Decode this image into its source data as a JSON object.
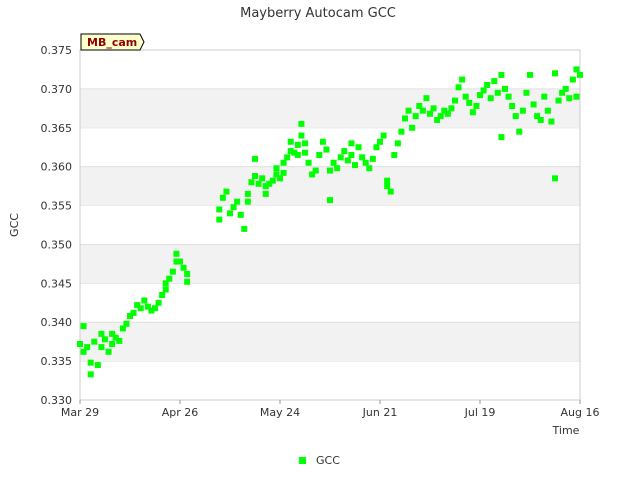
{
  "chart_data": {
    "type": "scatter",
    "title": "Mayberry Autocam GCC",
    "xlabel": "Time",
    "ylabel": "GCC",
    "site_tag": "MB_cam",
    "x_ticks": [
      "Mar 29",
      "Apr 26",
      "May 24",
      "Jun 21",
      "Jul 19",
      "Aug 16"
    ],
    "xlim": [
      "2016-03-29",
      "2016-08-16"
    ],
    "ylim": [
      0.33,
      0.375
    ],
    "y_ticks": [
      "0.330",
      "0.335",
      "0.340",
      "0.345",
      "0.350",
      "0.355",
      "0.360",
      "0.365",
      "0.370",
      "0.375"
    ],
    "grid": "alternating horizontal bands",
    "legend": "bottom-center",
    "colors": {
      "series": "#00ff00",
      "band": "#f2f2f2",
      "tag_bg": "#ffffcc"
    },
    "series": [
      {
        "name": "GCC",
        "points": [
          [
            "2016-03-29",
            0.3372
          ],
          [
            "2016-03-30",
            0.3362
          ],
          [
            "2016-03-30",
            0.3395
          ],
          [
            "2016-03-31",
            0.3368
          ],
          [
            "2016-04-01",
            0.3348
          ],
          [
            "2016-04-01",
            0.3333
          ],
          [
            "2016-04-02",
            0.3375
          ],
          [
            "2016-04-03",
            0.3345
          ],
          [
            "2016-04-04",
            0.3385
          ],
          [
            "2016-04-04",
            0.3368
          ],
          [
            "2016-04-05",
            0.3378
          ],
          [
            "2016-04-06",
            0.3362
          ],
          [
            "2016-04-07",
            0.3385
          ],
          [
            "2016-04-07",
            0.3372
          ],
          [
            "2016-04-08",
            0.338
          ],
          [
            "2016-04-09",
            0.3376
          ],
          [
            "2016-04-10",
            0.3392
          ],
          [
            "2016-04-11",
            0.3398
          ],
          [
            "2016-04-12",
            0.3408
          ],
          [
            "2016-04-13",
            0.3412
          ],
          [
            "2016-04-14",
            0.3422
          ],
          [
            "2016-04-15",
            0.3418
          ],
          [
            "2016-04-16",
            0.3428
          ],
          [
            "2016-04-17",
            0.342
          ],
          [
            "2016-04-18",
            0.3415
          ],
          [
            "2016-04-19",
            0.3418
          ],
          [
            "2016-04-20",
            0.3425
          ],
          [
            "2016-04-21",
            0.3435
          ],
          [
            "2016-04-22",
            0.3442
          ],
          [
            "2016-04-22",
            0.345
          ],
          [
            "2016-04-23",
            0.3456
          ],
          [
            "2016-04-24",
            0.3465
          ],
          [
            "2016-04-25",
            0.3478
          ],
          [
            "2016-04-25",
            0.3488
          ],
          [
            "2016-04-26",
            0.3478
          ],
          [
            "2016-04-27",
            0.347
          ],
          [
            "2016-04-28",
            0.3462
          ],
          [
            "2016-04-28",
            0.3452
          ],
          [
            "2016-05-07",
            0.3532
          ],
          [
            "2016-05-07",
            0.3545
          ],
          [
            "2016-05-08",
            0.356
          ],
          [
            "2016-05-09",
            0.3568
          ],
          [
            "2016-05-10",
            0.354
          ],
          [
            "2016-05-11",
            0.3548
          ],
          [
            "2016-05-12",
            0.3555
          ],
          [
            "2016-05-13",
            0.3538
          ],
          [
            "2016-05-14",
            0.352
          ],
          [
            "2016-05-15",
            0.3565
          ],
          [
            "2016-05-15",
            0.3555
          ],
          [
            "2016-05-16",
            0.358
          ],
          [
            "2016-05-17",
            0.3588
          ],
          [
            "2016-05-17",
            0.361
          ],
          [
            "2016-05-18",
            0.3578
          ],
          [
            "2016-05-19",
            0.3585
          ],
          [
            "2016-05-20",
            0.3565
          ],
          [
            "2016-05-20",
            0.3575
          ],
          [
            "2016-05-21",
            0.3578
          ],
          [
            "2016-05-22",
            0.3582
          ],
          [
            "2016-05-23",
            0.359
          ],
          [
            "2016-05-23",
            0.3598
          ],
          [
            "2016-05-24",
            0.3585
          ],
          [
            "2016-05-25",
            0.3592
          ],
          [
            "2016-05-25",
            0.3605
          ],
          [
            "2016-05-26",
            0.3612
          ],
          [
            "2016-05-27",
            0.362
          ],
          [
            "2016-05-27",
            0.3632
          ],
          [
            "2016-05-28",
            0.3618
          ],
          [
            "2016-05-29",
            0.3615
          ],
          [
            "2016-05-29",
            0.3628
          ],
          [
            "2016-05-30",
            0.364
          ],
          [
            "2016-05-30",
            0.3655
          ],
          [
            "2016-05-31",
            0.363
          ],
          [
            "2016-05-31",
            0.3618
          ],
          [
            "2016-06-01",
            0.3605
          ],
          [
            "2016-06-02",
            0.359
          ],
          [
            "2016-06-03",
            0.3595
          ],
          [
            "2016-06-04",
            0.3615
          ],
          [
            "2016-06-05",
            0.3632
          ],
          [
            "2016-06-06",
            0.3622
          ],
          [
            "2016-06-07",
            0.3557
          ],
          [
            "2016-06-07",
            0.3595
          ],
          [
            "2016-06-08",
            0.3605
          ],
          [
            "2016-06-09",
            0.3598
          ],
          [
            "2016-06-10",
            0.3612
          ],
          [
            "2016-06-11",
            0.362
          ],
          [
            "2016-06-12",
            0.3608
          ],
          [
            "2016-06-13",
            0.3615
          ],
          [
            "2016-06-13",
            0.363
          ],
          [
            "2016-06-14",
            0.3602
          ],
          [
            "2016-06-15",
            0.3625
          ],
          [
            "2016-06-16",
            0.3612
          ],
          [
            "2016-06-17",
            0.3605
          ],
          [
            "2016-06-18",
            0.3598
          ],
          [
            "2016-06-19",
            0.361
          ],
          [
            "2016-06-20",
            0.3625
          ],
          [
            "2016-06-21",
            0.3632
          ],
          [
            "2016-06-22",
            0.364
          ],
          [
            "2016-06-23",
            0.3582
          ],
          [
            "2016-06-23",
            0.3575
          ],
          [
            "2016-06-24",
            0.3568
          ],
          [
            "2016-06-25",
            0.3615
          ],
          [
            "2016-06-26",
            0.363
          ],
          [
            "2016-06-27",
            0.3645
          ],
          [
            "2016-06-28",
            0.3662
          ],
          [
            "2016-06-29",
            0.3672
          ],
          [
            "2016-06-30",
            0.365
          ],
          [
            "2016-07-01",
            0.3665
          ],
          [
            "2016-07-02",
            0.3678
          ],
          [
            "2016-07-03",
            0.3672
          ],
          [
            "2016-07-04",
            0.3688
          ],
          [
            "2016-07-05",
            0.3668
          ],
          [
            "2016-07-06",
            0.3675
          ],
          [
            "2016-07-07",
            0.366
          ],
          [
            "2016-07-08",
            0.3665
          ],
          [
            "2016-07-09",
            0.3672
          ],
          [
            "2016-07-10",
            0.3668
          ],
          [
            "2016-07-11",
            0.3675
          ],
          [
            "2016-07-12",
            0.3685
          ],
          [
            "2016-07-13",
            0.3702
          ],
          [
            "2016-07-14",
            0.3712
          ],
          [
            "2016-07-15",
            0.369
          ],
          [
            "2016-07-16",
            0.3682
          ],
          [
            "2016-07-17",
            0.367
          ],
          [
            "2016-07-18",
            0.3678
          ],
          [
            "2016-07-19",
            0.3692
          ],
          [
            "2016-07-20",
            0.3698
          ],
          [
            "2016-07-21",
            0.3705
          ],
          [
            "2016-07-22",
            0.3688
          ],
          [
            "2016-07-23",
            0.371
          ],
          [
            "2016-07-24",
            0.3695
          ],
          [
            "2016-07-25",
            0.3638
          ],
          [
            "2016-07-25",
            0.3718
          ],
          [
            "2016-07-26",
            0.37
          ],
          [
            "2016-07-27",
            0.369
          ],
          [
            "2016-07-28",
            0.3678
          ],
          [
            "2016-07-29",
            0.3665
          ],
          [
            "2016-07-30",
            0.3645
          ],
          [
            "2016-07-31",
            0.3672
          ],
          [
            "2016-08-01",
            0.3695
          ],
          [
            "2016-08-02",
            0.3718
          ],
          [
            "2016-08-03",
            0.368
          ],
          [
            "2016-08-04",
            0.3665
          ],
          [
            "2016-08-05",
            0.366
          ],
          [
            "2016-08-06",
            0.369
          ],
          [
            "2016-08-07",
            0.3672
          ],
          [
            "2016-08-08",
            0.3658
          ],
          [
            "2016-08-09",
            0.3585
          ],
          [
            "2016-08-09",
            0.372
          ],
          [
            "2016-08-10",
            0.3685
          ],
          [
            "2016-08-11",
            0.3695
          ],
          [
            "2016-08-12",
            0.37
          ],
          [
            "2016-08-13",
            0.3688
          ],
          [
            "2016-08-14",
            0.3712
          ],
          [
            "2016-08-15",
            0.3725
          ],
          [
            "2016-08-15",
            0.369
          ],
          [
            "2016-08-16",
            0.3718
          ]
        ]
      }
    ]
  }
}
